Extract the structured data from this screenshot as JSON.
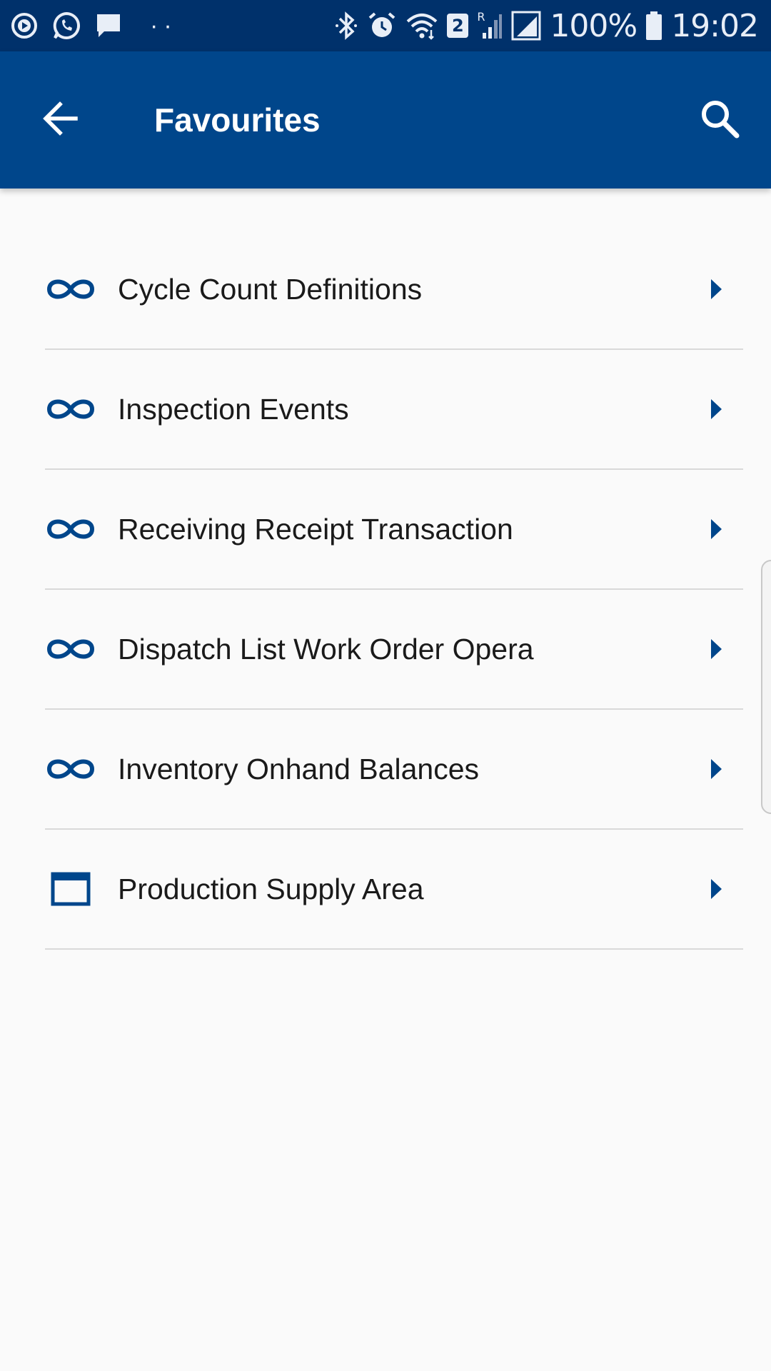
{
  "status_bar": {
    "left_icons": [
      "media-player-icon",
      "whatsapp-icon",
      "message-icon"
    ],
    "overflow_indicator": "··",
    "right_icons": [
      "bluetooth-icon",
      "alarm-icon",
      "wifi-icon",
      "sim2-icon",
      "roaming-signal-icon",
      "signal-icon",
      "battery-icon"
    ],
    "sim_badge": "2",
    "roaming_mark": "R",
    "battery_percent": "100%",
    "time": "19:02"
  },
  "app_bar": {
    "back_icon": "arrow-left-icon",
    "title": "Favourites",
    "search_icon": "search-icon"
  },
  "colors": {
    "status_bar": "#00316b",
    "app_bar": "#00468b",
    "accent": "#00468b",
    "background": "#fafafa",
    "divider": "#d9d9d9"
  },
  "favourites": [
    {
      "label": "Cycle Count Definitions",
      "icon": "infinity-icon"
    },
    {
      "label": "Inspection Events",
      "icon": "infinity-icon"
    },
    {
      "label": "Receiving Receipt Transaction",
      "icon": "infinity-icon"
    },
    {
      "label": "Dispatch List Work Order Opera",
      "icon": "infinity-icon"
    },
    {
      "label": "Inventory Onhand Balances",
      "icon": "infinity-icon"
    },
    {
      "label": "Production Supply Area",
      "icon": "window-icon"
    }
  ]
}
